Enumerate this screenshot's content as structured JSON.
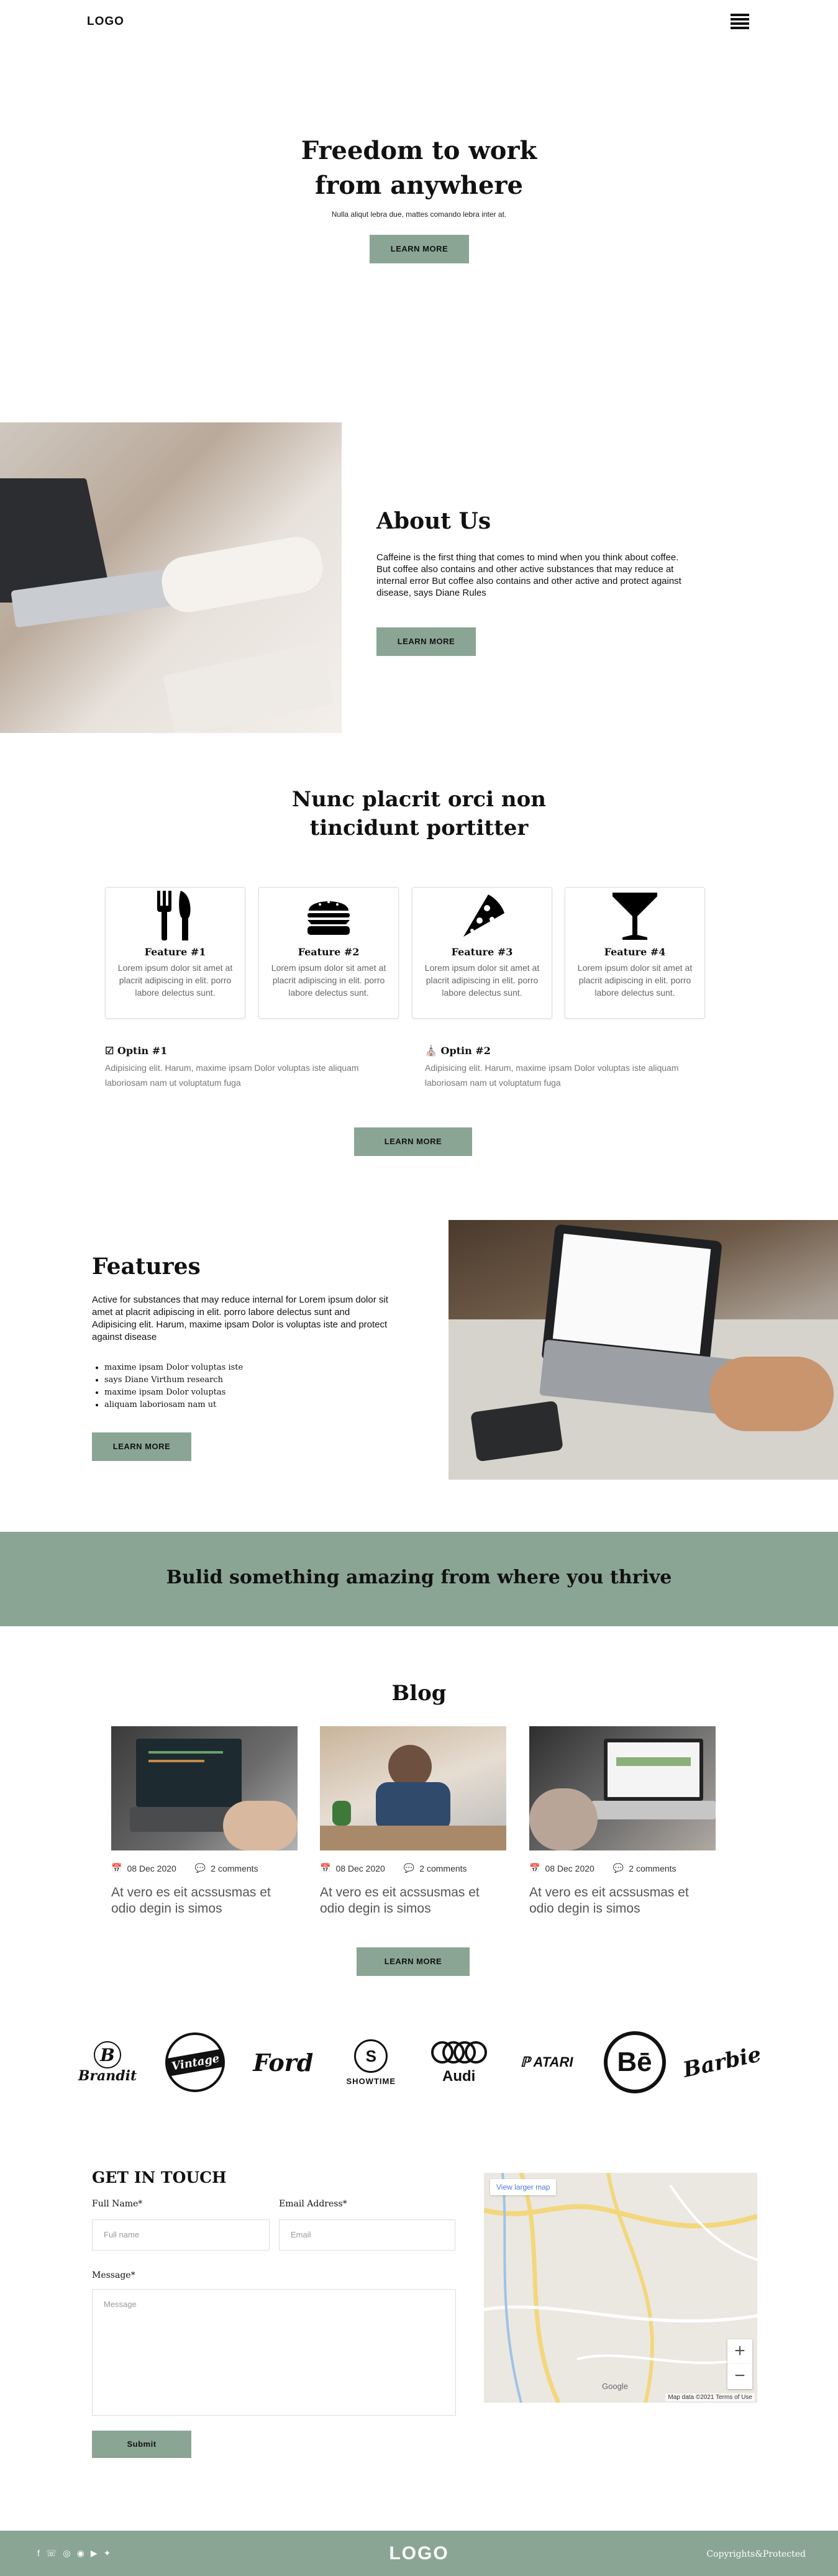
{
  "header": {
    "logo": "LOGO",
    "menu_icon": "hamburger-menu-icon"
  },
  "hero": {
    "title_line1": "Freedom to work",
    "title_line2": "from anywhere",
    "subtitle": "Nulla aliqut lebra due, mattes comando lebra inter at.",
    "button": "LEARN MORE"
  },
  "about": {
    "title": "About Us",
    "text": "Caffeine is the first thing that comes to mind when you think about coffee. But coffee also contains and other active substances that may reduce at internal error But coffee also contains and other active and protect against disease, says Diane Rules",
    "button": "LEARN MORE"
  },
  "section2": {
    "title_line1": "Nunc placrit orci non",
    "title_line2": "tincidunt portitter",
    "features": [
      {
        "icon": "cutlery-icon",
        "title": "Feature #1",
        "text": "Lorem ipsum dolor sit amet at placrit adipiscing in elit. porro labore delectus sunt."
      },
      {
        "icon": "burger-icon",
        "title": "Feature #2",
        "text": "Lorem ipsum dolor sit amet at placrit adipiscing in elit. porro labore delectus sunt."
      },
      {
        "icon": "pizza-icon",
        "title": "Feature #3",
        "text": "Lorem ipsum dolor sit amet at placrit adipiscing in elit. porro labore delectus sunt."
      },
      {
        "icon": "cocktail-icon",
        "title": "Feature #4",
        "text": "Lorem ipsum dolor sit amet at placrit adipiscing in elit. porro labore delectus sunt."
      }
    ],
    "optins": [
      {
        "icon": "tag-icon",
        "title": "Optin #1",
        "text": "Adipisicing elit. Harum, maxime ipsam Dolor voluptas iste aliquam laboriosam nam ut voluptatum fuga"
      },
      {
        "icon": "bank-icon",
        "title": "Optin #2",
        "text": "Adipisicing elit. Harum, maxime ipsam Dolor voluptas iste aliquam laboriosam nam ut voluptatum fuga"
      }
    ],
    "button": "LEARN MORE"
  },
  "features": {
    "title": "Features",
    "text": "Active for substances that may reduce internal for Lorem ipsum dolor sit amet at placrit adipiscing in elit. porro labore delectus sunt and Adipisicing elit. Harum, maxime ipsam Dolor is voluptas iste and protect against disease",
    "list": [
      "maxime ipsam Dolor voluptas iste",
      "says Diane Virthum research",
      "maxime ipsam Dolor voluptas",
      "aliquam laboriosam nam ut"
    ],
    "button": "LEARN MORE"
  },
  "banner": {
    "text": "Bulid something amazing from where you thrive"
  },
  "blog": {
    "title": "Blog",
    "posts": [
      {
        "date": "08 Dec 2020",
        "comments": "2 comments",
        "title": "At vero es eit acssusmas et odio degin is simos"
      },
      {
        "date": "08 Dec 2020",
        "comments": "2 comments",
        "title": "At vero es eit acssusmas et odio degin is simos"
      },
      {
        "date": "08 Dec 2020",
        "comments": "2 comments",
        "title": "At vero es eit acssusmas et odio degin is simos"
      }
    ],
    "button": "LEARN MORE"
  },
  "brands": [
    {
      "name": "Brandit"
    },
    {
      "name": "Vintage"
    },
    {
      "name": "Ford"
    },
    {
      "name": "SHOWTIME"
    },
    {
      "name": "Audi"
    },
    {
      "name": "ATARI"
    },
    {
      "name": "Bē"
    },
    {
      "name": "Barbie"
    }
  ],
  "contact": {
    "title": "GET IN TOUCH",
    "fullname_label": "Full Name*",
    "fullname_placeholder": "Full name",
    "email_label": "Email Address*",
    "email_placeholder": "Email",
    "message_label": "Message*",
    "message_placeholder": "Message",
    "submit": "Submit"
  },
  "map": {
    "link": "View larger map",
    "zoom_in": "+",
    "zoom_out": "−",
    "attribution": "Map data ©2021   Terms of Use",
    "google": "Google"
  },
  "footer": {
    "logo": "LOGO",
    "copyright": "Copyrights&Protected",
    "social_icons": [
      "facebook-icon",
      "whatsapp-icon",
      "dribbble-icon",
      "instagram-icon",
      "youtube-icon",
      "twitter-icon"
    ]
  },
  "colors": {
    "accent": "#8aa594"
  }
}
